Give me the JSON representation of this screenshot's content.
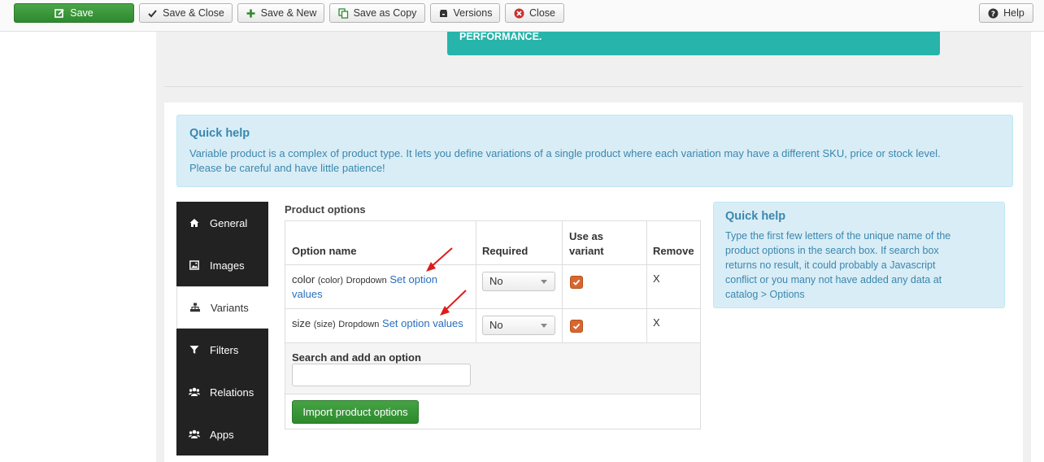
{
  "toolbar": {
    "save": "Save",
    "save_close": "Save & Close",
    "save_new": "Save & New",
    "save_copy": "Save as Copy",
    "versions": "Versions",
    "close": "Close",
    "help": "Help"
  },
  "banner": {
    "text": "PERFORMANCE."
  },
  "quick_help_top": {
    "title": "Quick help",
    "line1": "Variable product is a complex of product type. It lets you define variations of a single product where each variation may have a different SKU, price or stock level.",
    "line2": "Please be careful and have little patience!"
  },
  "tabs": [
    {
      "label": "General",
      "icon": "home-icon"
    },
    {
      "label": "Images",
      "icon": "image-icon"
    },
    {
      "label": "Variants",
      "icon": "sitemap-icon"
    },
    {
      "label": "Filters",
      "icon": "filter-icon"
    },
    {
      "label": "Relations",
      "icon": "users-icon"
    },
    {
      "label": "Apps",
      "icon": "users-icon"
    }
  ],
  "options": {
    "title": "Product options",
    "headers": {
      "name": "Option name",
      "required": "Required",
      "variant_line1": "Use as",
      "variant_line2": "variant",
      "remove": "Remove"
    },
    "rows": [
      {
        "name": "color",
        "code": "(color)",
        "type": "Dropdown",
        "link1": "Set option",
        "link2": "values",
        "required": "No",
        "variant": true,
        "remove": "X"
      },
      {
        "name": "size",
        "code": "(size)",
        "type": "Dropdown",
        "link": "Set option values",
        "required": "No",
        "variant": true,
        "remove": "X"
      }
    ],
    "search_label": "Search and add an option",
    "import_button": "Import product options"
  },
  "quick_help_side": {
    "title": "Quick help",
    "lines": [
      "Type the first few letters of the unique name of the",
      "product options in the search box. If search box",
      "returns no result, it could probably a Javascript",
      "conflict or you many not have added any data at",
      "catalog > Options"
    ]
  },
  "colors": {
    "save_green": "#3a9a3a",
    "teal": "#27b4aa",
    "help_bg": "#d9edf7",
    "help_text": "#3a87ad",
    "checkbox": "#d9662f",
    "annotation_arrow": "#e01b1b"
  }
}
